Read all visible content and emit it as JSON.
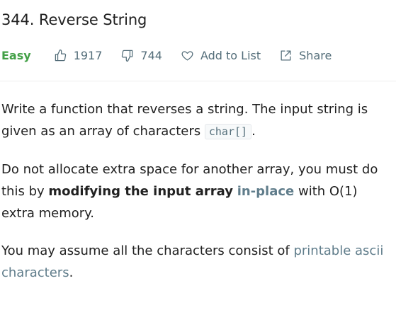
{
  "problem": {
    "title": "344. Reverse String",
    "difficulty": "Easy",
    "likes": "1917",
    "dislikes": "744",
    "add_to_list": "Add to List",
    "share": "Share"
  },
  "description": {
    "p1_text": "Write a function that reverses a string. The input string is given as an array of characters",
    "p1_code": "char[]",
    "p1_end": ".",
    "p2_start": "Do not allocate extra space for another array, you must do this by",
    "p2_bold": "modifying the input array",
    "p2_link": "in-place",
    "p2_end": "with O(1) extra memory.",
    "p3_start": "You may assume all the characters consist of",
    "p3_link": "printable ascii characters",
    "p3_end": "."
  },
  "colors": {
    "easy": "#43a047",
    "link": "#607d8b",
    "meta": "#546e7a"
  }
}
